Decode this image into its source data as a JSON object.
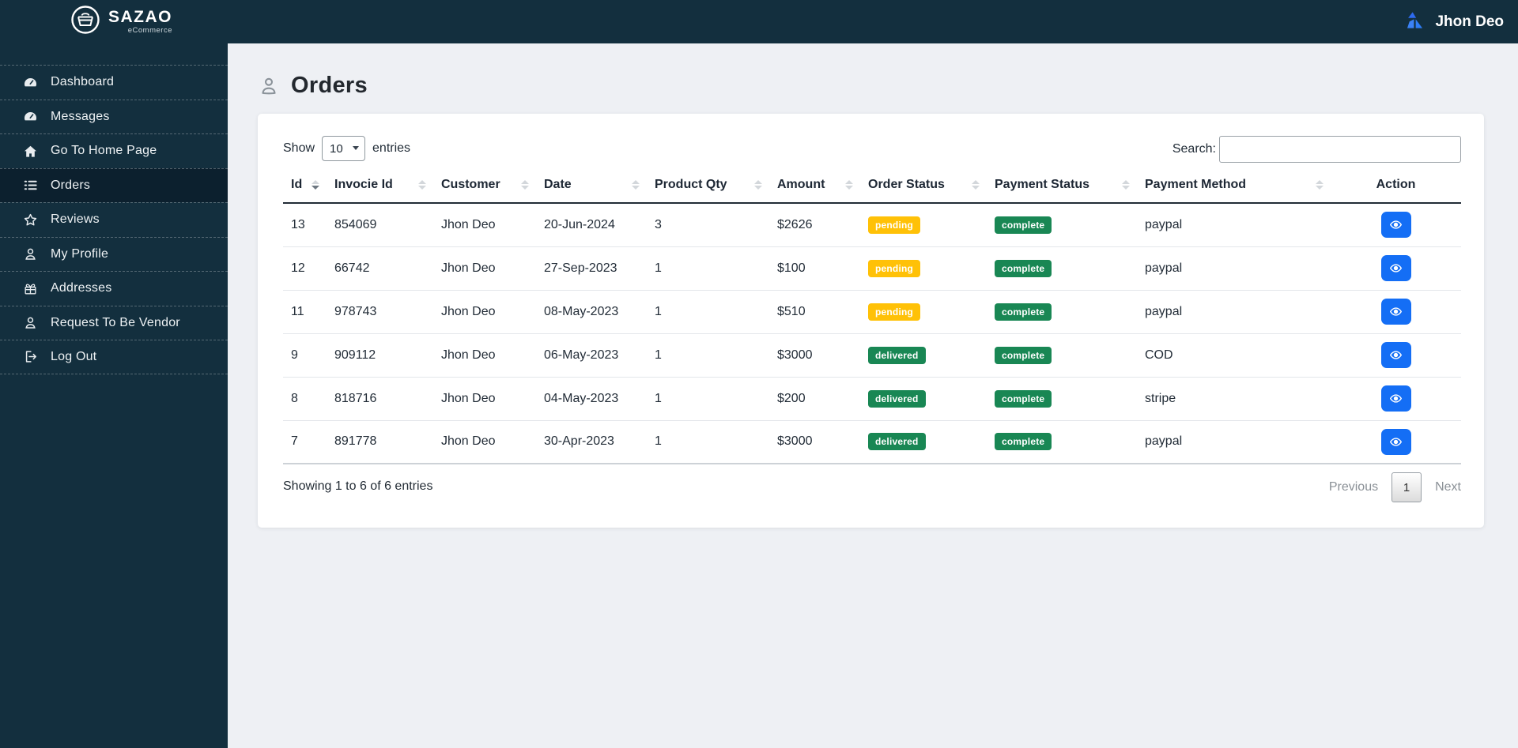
{
  "brand": {
    "name": "SAZAO",
    "tagline": "eCommerce"
  },
  "topbar": {
    "user_name": "Jhon Deo"
  },
  "sidebar": {
    "items": [
      {
        "label": "Dashboard",
        "icon": "tachometer-icon",
        "active": false
      },
      {
        "label": "Messages",
        "icon": "tachometer-icon",
        "active": false
      },
      {
        "label": "Go To Home Page",
        "icon": "home-icon",
        "active": false
      },
      {
        "label": "Orders",
        "icon": "list-icon",
        "active": true
      },
      {
        "label": "Reviews",
        "icon": "star-icon",
        "active": false
      },
      {
        "label": "My Profile",
        "icon": "user-icon",
        "active": false
      },
      {
        "label": "Addresses",
        "icon": "gift-icon",
        "active": false
      },
      {
        "label": "Request To Be Vendor",
        "icon": "user-icon",
        "active": false
      },
      {
        "label": "Log Out",
        "icon": "logout-icon",
        "active": false
      }
    ]
  },
  "page": {
    "title": "Orders"
  },
  "controls": {
    "show_label": "Show",
    "page_length": "10",
    "entries_label": "entries",
    "search_label": "Search:",
    "search_value": ""
  },
  "table": {
    "columns": [
      "Id",
      "Invocie Id",
      "Customer",
      "Date",
      "Product Qty",
      "Amount",
      "Order Status",
      "Payment Status",
      "Payment Method",
      "Action"
    ],
    "sorted_column": "Id",
    "sort_direction": "descending",
    "rows": [
      {
        "id": "13",
        "invoice_id": "854069",
        "customer": "Jhon Deo",
        "date": "20-Jun-2024",
        "qty": "3",
        "amount": "$2626",
        "order_status": "pending",
        "payment_status": "complete",
        "payment_method": "paypal"
      },
      {
        "id": "12",
        "invoice_id": "66742",
        "customer": "Jhon Deo",
        "date": "27-Sep-2023",
        "qty": "1",
        "amount": "$100",
        "order_status": "pending",
        "payment_status": "complete",
        "payment_method": "paypal"
      },
      {
        "id": "11",
        "invoice_id": "978743",
        "customer": "Jhon Deo",
        "date": "08-May-2023",
        "qty": "1",
        "amount": "$510",
        "order_status": "pending",
        "payment_status": "complete",
        "payment_method": "paypal"
      },
      {
        "id": "9",
        "invoice_id": "909112",
        "customer": "Jhon Deo",
        "date": "06-May-2023",
        "qty": "1",
        "amount": "$3000",
        "order_status": "delivered",
        "payment_status": "complete",
        "payment_method": "COD"
      },
      {
        "id": "8",
        "invoice_id": "818716",
        "customer": "Jhon Deo",
        "date": "04-May-2023",
        "qty": "1",
        "amount": "$200",
        "order_status": "delivered",
        "payment_status": "complete",
        "payment_method": "stripe"
      },
      {
        "id": "7",
        "invoice_id": "891778",
        "customer": "Jhon Deo",
        "date": "30-Apr-2023",
        "qty": "1",
        "amount": "$3000",
        "order_status": "delivered",
        "payment_status": "complete",
        "payment_method": "paypal"
      }
    ]
  },
  "footer": {
    "info": "Showing 1 to 6 of 6 entries",
    "previous_label": "Previous",
    "current_page": "1",
    "next_label": "Next"
  },
  "colors": {
    "navbar_bg": "#132f3e",
    "active_item_bg": "#0c202e",
    "pending_badge": "#ffc107",
    "success_badge": "#198754",
    "action_button": "#146ef5"
  }
}
